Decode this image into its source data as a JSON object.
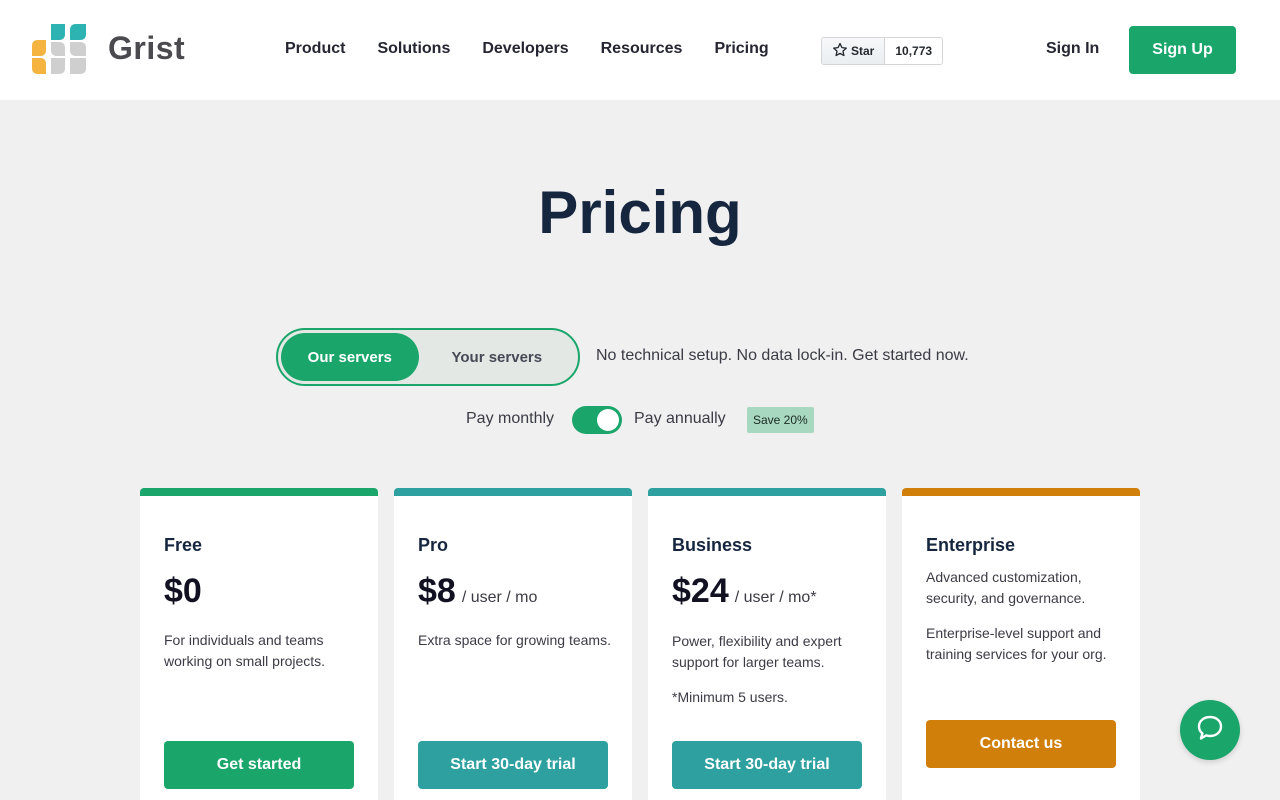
{
  "brand": {
    "name": "Grist"
  },
  "nav": {
    "items": [
      "Product",
      "Solutions",
      "Developers",
      "Resources",
      "Pricing"
    ]
  },
  "github": {
    "star_label": "Star",
    "count": "10,773"
  },
  "auth": {
    "signin": "Sign In",
    "signup": "Sign Up"
  },
  "colors": {
    "accent": "#1aa66b",
    "teal": "#2ea0a0",
    "orange": "#d07f0a",
    "title": "#16263f"
  },
  "page": {
    "title": "Pricing"
  },
  "server_toggle": {
    "options": [
      "Our servers",
      "Your servers"
    ],
    "selected": "Our servers",
    "description": "No technical setup. No data lock-in. Get started now."
  },
  "billing": {
    "monthly": "Pay monthly",
    "annually": "Pay annually",
    "selected": "annually",
    "badge": "Save 20%"
  },
  "plans": [
    {
      "name": "Free",
      "price": "$0",
      "unit": "",
      "desc": "For individuals and teams working on small projects.",
      "note": "",
      "cta": "Get started",
      "color": "#1aa66b"
    },
    {
      "name": "Pro",
      "price": "$8",
      "unit": "/ user / mo",
      "desc": "Extra space for growing teams.",
      "note": "",
      "cta": "Start 30-day trial",
      "color": "#2ea0a0"
    },
    {
      "name": "Business",
      "price": "$24",
      "unit": "/ user / mo*",
      "desc": "Power, flexibility and expert support for larger teams.",
      "note": "*Minimum 5 users.",
      "cta": "Start 30-day trial",
      "color": "#2ea0a0"
    },
    {
      "name": "Enterprise",
      "price": "",
      "unit": "",
      "desc": "Advanced customization, security, and governance.",
      "note": "Enterprise-level support and training services for your org.",
      "cta": "Contact us",
      "color": "#d07f0a"
    }
  ],
  "icons": {
    "chat": "chat-bubble-icon",
    "star": "star-icon"
  }
}
